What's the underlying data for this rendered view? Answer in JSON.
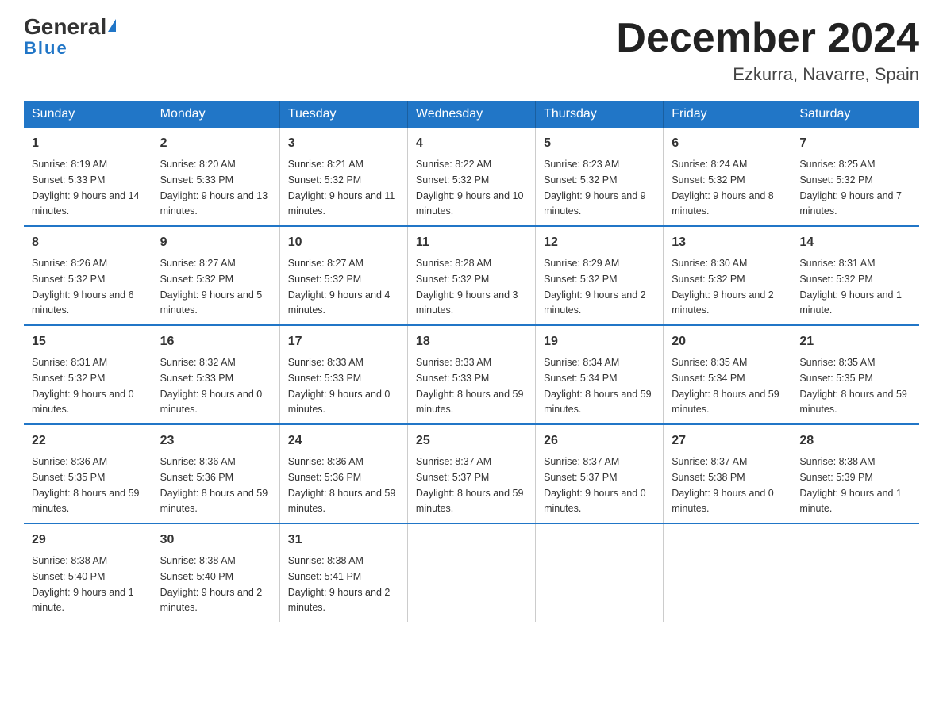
{
  "header": {
    "logo_general": "General",
    "logo_blue": "Blue",
    "month_title": "December 2024",
    "location": "Ezkurra, Navarre, Spain"
  },
  "days_of_week": [
    "Sunday",
    "Monday",
    "Tuesday",
    "Wednesday",
    "Thursday",
    "Friday",
    "Saturday"
  ],
  "weeks": [
    [
      {
        "day": "1",
        "sunrise": "8:19 AM",
        "sunset": "5:33 PM",
        "daylight": "9 hours and 14 minutes."
      },
      {
        "day": "2",
        "sunrise": "8:20 AM",
        "sunset": "5:33 PM",
        "daylight": "9 hours and 13 minutes."
      },
      {
        "day": "3",
        "sunrise": "8:21 AM",
        "sunset": "5:32 PM",
        "daylight": "9 hours and 11 minutes."
      },
      {
        "day": "4",
        "sunrise": "8:22 AM",
        "sunset": "5:32 PM",
        "daylight": "9 hours and 10 minutes."
      },
      {
        "day": "5",
        "sunrise": "8:23 AM",
        "sunset": "5:32 PM",
        "daylight": "9 hours and 9 minutes."
      },
      {
        "day": "6",
        "sunrise": "8:24 AM",
        "sunset": "5:32 PM",
        "daylight": "9 hours and 8 minutes."
      },
      {
        "day": "7",
        "sunrise": "8:25 AM",
        "sunset": "5:32 PM",
        "daylight": "9 hours and 7 minutes."
      }
    ],
    [
      {
        "day": "8",
        "sunrise": "8:26 AM",
        "sunset": "5:32 PM",
        "daylight": "9 hours and 6 minutes."
      },
      {
        "day": "9",
        "sunrise": "8:27 AM",
        "sunset": "5:32 PM",
        "daylight": "9 hours and 5 minutes."
      },
      {
        "day": "10",
        "sunrise": "8:27 AM",
        "sunset": "5:32 PM",
        "daylight": "9 hours and 4 minutes."
      },
      {
        "day": "11",
        "sunrise": "8:28 AM",
        "sunset": "5:32 PM",
        "daylight": "9 hours and 3 minutes."
      },
      {
        "day": "12",
        "sunrise": "8:29 AM",
        "sunset": "5:32 PM",
        "daylight": "9 hours and 2 minutes."
      },
      {
        "day": "13",
        "sunrise": "8:30 AM",
        "sunset": "5:32 PM",
        "daylight": "9 hours and 2 minutes."
      },
      {
        "day": "14",
        "sunrise": "8:31 AM",
        "sunset": "5:32 PM",
        "daylight": "9 hours and 1 minute."
      }
    ],
    [
      {
        "day": "15",
        "sunrise": "8:31 AM",
        "sunset": "5:32 PM",
        "daylight": "9 hours and 0 minutes."
      },
      {
        "day": "16",
        "sunrise": "8:32 AM",
        "sunset": "5:33 PM",
        "daylight": "9 hours and 0 minutes."
      },
      {
        "day": "17",
        "sunrise": "8:33 AM",
        "sunset": "5:33 PM",
        "daylight": "9 hours and 0 minutes."
      },
      {
        "day": "18",
        "sunrise": "8:33 AM",
        "sunset": "5:33 PM",
        "daylight": "8 hours and 59 minutes."
      },
      {
        "day": "19",
        "sunrise": "8:34 AM",
        "sunset": "5:34 PM",
        "daylight": "8 hours and 59 minutes."
      },
      {
        "day": "20",
        "sunrise": "8:35 AM",
        "sunset": "5:34 PM",
        "daylight": "8 hours and 59 minutes."
      },
      {
        "day": "21",
        "sunrise": "8:35 AM",
        "sunset": "5:35 PM",
        "daylight": "8 hours and 59 minutes."
      }
    ],
    [
      {
        "day": "22",
        "sunrise": "8:36 AM",
        "sunset": "5:35 PM",
        "daylight": "8 hours and 59 minutes."
      },
      {
        "day": "23",
        "sunrise": "8:36 AM",
        "sunset": "5:36 PM",
        "daylight": "8 hours and 59 minutes."
      },
      {
        "day": "24",
        "sunrise": "8:36 AM",
        "sunset": "5:36 PM",
        "daylight": "8 hours and 59 minutes."
      },
      {
        "day": "25",
        "sunrise": "8:37 AM",
        "sunset": "5:37 PM",
        "daylight": "8 hours and 59 minutes."
      },
      {
        "day": "26",
        "sunrise": "8:37 AM",
        "sunset": "5:37 PM",
        "daylight": "9 hours and 0 minutes."
      },
      {
        "day": "27",
        "sunrise": "8:37 AM",
        "sunset": "5:38 PM",
        "daylight": "9 hours and 0 minutes."
      },
      {
        "day": "28",
        "sunrise": "8:38 AM",
        "sunset": "5:39 PM",
        "daylight": "9 hours and 1 minute."
      }
    ],
    [
      {
        "day": "29",
        "sunrise": "8:38 AM",
        "sunset": "5:40 PM",
        "daylight": "9 hours and 1 minute."
      },
      {
        "day": "30",
        "sunrise": "8:38 AM",
        "sunset": "5:40 PM",
        "daylight": "9 hours and 2 minutes."
      },
      {
        "day": "31",
        "sunrise": "8:38 AM",
        "sunset": "5:41 PM",
        "daylight": "9 hours and 2 minutes."
      },
      {
        "day": "",
        "sunrise": "",
        "sunset": "",
        "daylight": ""
      },
      {
        "day": "",
        "sunrise": "",
        "sunset": "",
        "daylight": ""
      },
      {
        "day": "",
        "sunrise": "",
        "sunset": "",
        "daylight": ""
      },
      {
        "day": "",
        "sunrise": "",
        "sunset": "",
        "daylight": ""
      }
    ]
  ]
}
